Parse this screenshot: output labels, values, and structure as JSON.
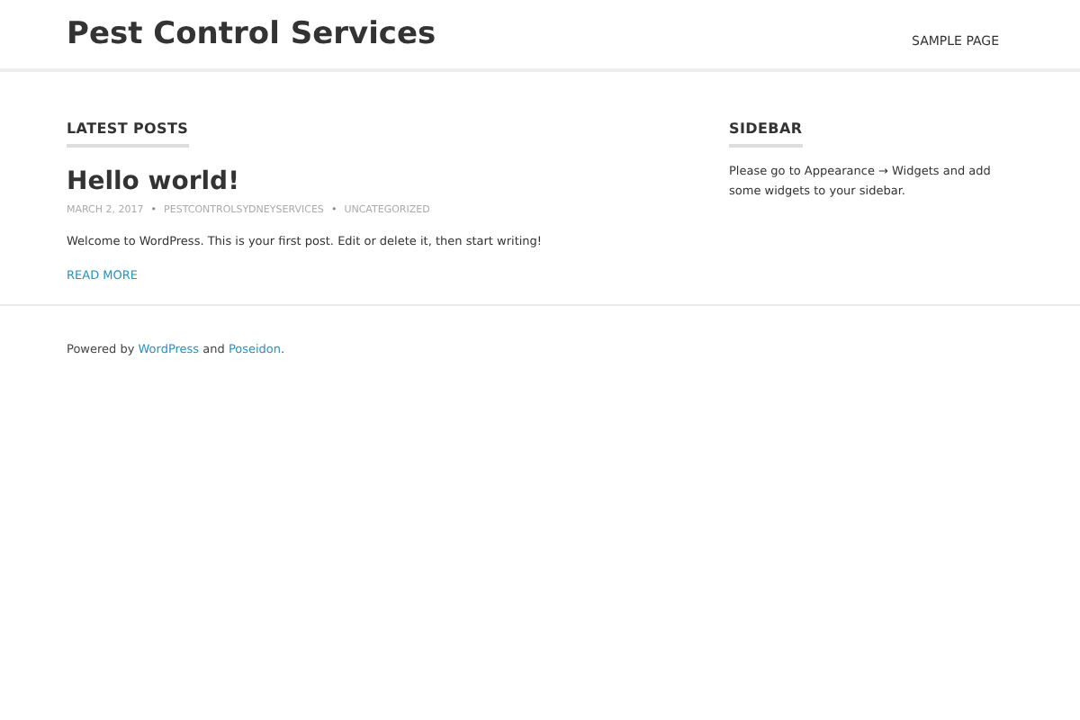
{
  "header": {
    "site_title": "Pest Control Services",
    "nav": [
      {
        "label": "SAMPLE PAGE"
      }
    ]
  },
  "main": {
    "heading": "LATEST POSTS",
    "posts": [
      {
        "title": "Hello world!",
        "meta": [
          "MARCH 2, 2017",
          "PESTCONTROLSYDNEYSERVICES",
          "UNCATEGORIZED"
        ],
        "separator": "•",
        "excerpt": "Welcome to WordPress. This is your first post. Edit or delete it, then start writing!",
        "read_more": "READ MORE"
      }
    ]
  },
  "sidebar": {
    "heading": "SIDEBAR",
    "text": "Please go to Appearance → Widgets and add some widgets to your sidebar."
  },
  "footer": {
    "parts": [
      {
        "kind": "text",
        "text": "Powered by "
      },
      {
        "kind": "link",
        "text": "WordPress"
      },
      {
        "kind": "text",
        "text": " and "
      },
      {
        "kind": "link",
        "text": "Poseidon"
      },
      {
        "kind": "text",
        "text": "."
      }
    ]
  }
}
